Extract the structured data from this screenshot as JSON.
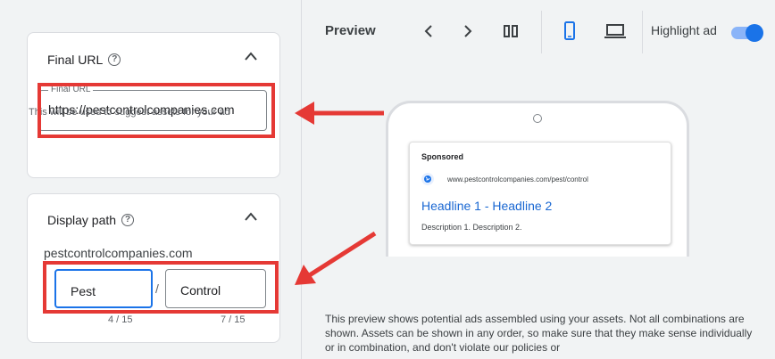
{
  "final_url_card": {
    "title": "Final URL",
    "help_icon": "help-circle-icon",
    "field_label": "Final URL",
    "field_value": "https://pestcontrolcompanies.com",
    "hint": "This will be used to suggest assets for your ad"
  },
  "display_path_card": {
    "title": "Display path",
    "domain": "pestcontrolcompanies.com",
    "path1": "Pest",
    "path2": "Control",
    "separator": "/",
    "path1_count": "4 / 15",
    "path2_count": "7 / 15"
  },
  "preview": {
    "title": "Preview",
    "highlight_label": "Highlight ad",
    "highlight_on": true,
    "ad": {
      "sponsored": "Sponsored",
      "url": "www.pestcontrolcompanies.com/pest/control",
      "headline": "Headline 1 - Headline 2",
      "description": "Description 1. Description 2."
    },
    "disclaimer": "This preview shows potential ads assembled using your assets. Not all combinations are shown. Assets can be shown in any order, so make sure that they make sense individually or in combination, and don't violate our policies or"
  },
  "colors": {
    "accent": "#1a73e8",
    "annotation_red": "#e53935"
  }
}
